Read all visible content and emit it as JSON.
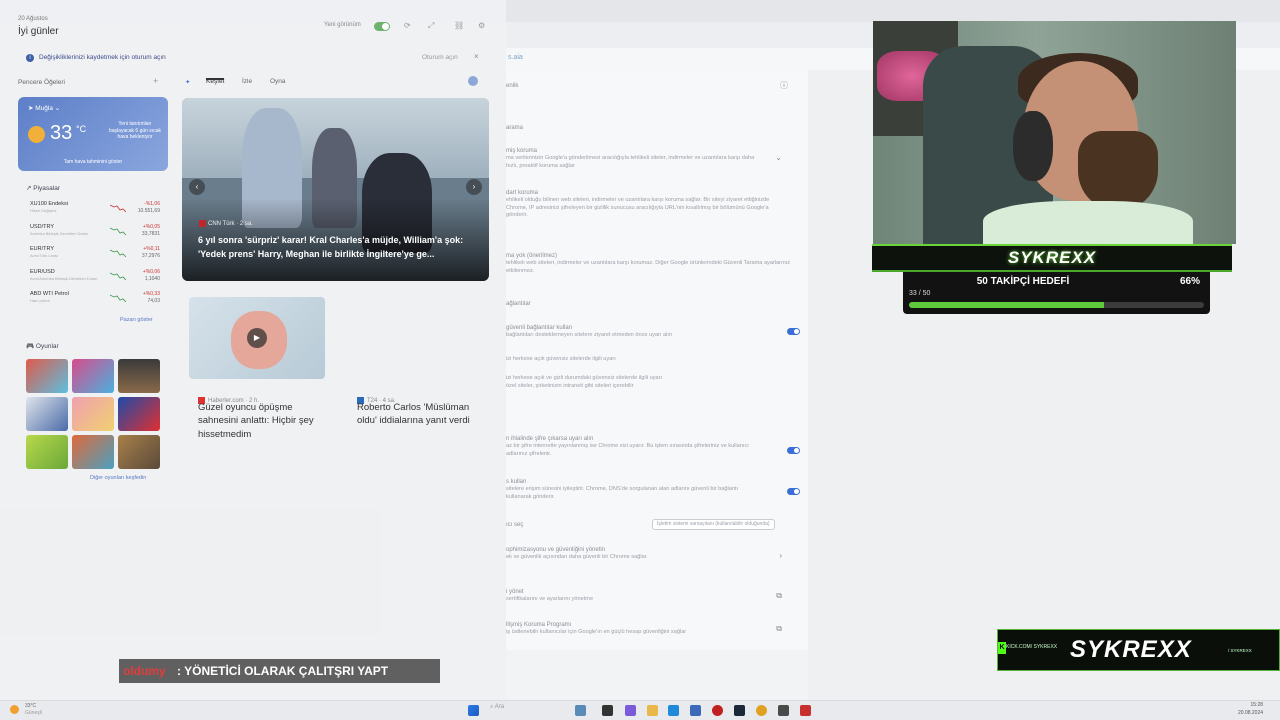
{
  "widgets": {
    "date": "20 Ağustos",
    "greeting": "İyi günler",
    "new_look_label": "Yeni görünüm",
    "notice": {
      "text": "Değişikliklerinizi kaydetmek için oturum açın",
      "signin": "Oturum açın"
    },
    "panels_label": "Pencere Öğeleri",
    "weather": {
      "city": "Muğla",
      "temp": "33",
      "unit": "°C",
      "note": "Yeni tanıtımları başlayacak 6 gün sıcak hava bekleniyor",
      "link": "Tam hava tahminini göster"
    },
    "markets": {
      "title": "Piyasalar",
      "more": "Pazarı göster",
      "items": [
        {
          "name": "XU100 Endeksi",
          "sub": "Hisse Değişimi",
          "change": "-%1,06",
          "value": "10.551,69"
        },
        {
          "name": "USD/TRY",
          "sub": "Amerika Birleşik Devletleri Doları",
          "change": "+%0,05",
          "value": "33,7831"
        },
        {
          "name": "EUR/TRY",
          "sub": "Avro/Türk Lirası",
          "change": "+%0,11",
          "value": "37,2976"
        },
        {
          "name": "EUR/USD",
          "sub": "Avro/Amerika Birleşik Devletleri Doları",
          "change": "+%0,06",
          "value": "1,1040"
        },
        {
          "name": "ABD WTI Petrol",
          "sub": "Ham petrol",
          "change": "+%0,33",
          "value": "74,03"
        }
      ]
    },
    "games": {
      "title": "Oyunlar",
      "more": "Diğer oyunları keşfedin"
    },
    "feed": {
      "tabs": [
        "Keşfet",
        "İzle",
        "Oyna"
      ]
    },
    "hero": {
      "source": "CNN Türk · 2 sa.",
      "title": "6 yıl sonra 'sürpriz' karar! Kral Charles'a müjde, William'a şok: 'Yedek prens' Harry, Meghan ile birlikte İngiltere'ye ge..."
    },
    "cards": [
      {
        "source": "Haberler.com · 2 h.",
        "title": "Güzel oyuncu öpüşme sahnesini anlattı: Hiçbir şey hissetmedim"
      },
      {
        "source": "T24 · 4 sa.",
        "title": "Roberto Carlos 'Müslüman oldu' iddialarına yanıt verdi"
      }
    ]
  },
  "settings": {
    "address": "s.aia",
    "rows": [
      {
        "title": "enlik",
        "desc": ""
      },
      {
        "title": "arama",
        "desc": ""
      },
      {
        "title": "miş koruma",
        "desc": "ma verilerinizin Google'a gönderilmesi aracılığıyla tehlikeli siteler, indirmeler ve uzantılara karşı daha hızlı, proaktif koruma sağlar"
      },
      {
        "title": "dart koruma",
        "desc": "ehlikeli olduğu bilinen web siteleri, indirmeler ve uzantılara karşı koruma sağlar. Bir siteyi ziyaret ettiğinizde Chrome, IP adresinizi şifreleyen bir gizlilik sunucusu aracılığıyla URL'nin kısaltılmış bir bölümünü Google'a gönderir."
      },
      {
        "title": "ma yok (önerilmez)",
        "desc": "tehlikeli web siteleri, indirmeler ve uzantılara karşı korumaz. Diğer Google ürünlerindeki Güvenli Tarama ayarlarınız etkilenmez."
      },
      {
        "title": "ağlantılar",
        "desc": ""
      },
      {
        "title": "güvenli bağlantılar kullan",
        "desc": "bağlantıları desteklemeyen sitelere ziyaret etmeden önce uyarı alın"
      },
      {
        "title": "izi herkese açık güvensiz sitelerde ilgili uyarı",
        "desc": ""
      },
      {
        "title": "izi herkese açık ve gizli durumdaki güvensiz sitelerde ilgili uyarı",
        "desc": "özel siteler, şirketinizin intraneti gibi siteleri içerebilir"
      },
      {
        "title": "n ihlalinde şifre çıkarsa uyarı alın",
        "desc": "az bir şifre internette yayınlanmış ise Chrome sizi uyarır. Bu işlem sırasında şifreleriniz ve kullanıcı adlarınız şifrelenir."
      },
      {
        "title": "s kullan",
        "desc": "sitelere erişim süresini iyileştirir. Chrome, DNS'de sorgulanan alan adlarını güvenli bir bağlantı kullanarak gönderir."
      },
      {
        "title": "ıcı seç",
        "desc": ""
      },
      {
        "title": "ophimizasyonu ve güvenliğini yönetin",
        "desc": "ek ve güvenlik açısından daha güvenli bir Chrome sağlar."
      },
      {
        "title": "i yönet",
        "desc": "sertifikalarını ve ayarlarını yönetme"
      },
      {
        "title": "llişmiş Koruma Programı",
        "desc": "iş üstlenebilir kullanıcılar için Google'ın en güçlü hesap güvenliğini sağlar"
      }
    ],
    "dns_select": "İşletim sistemi varsayılanı (kullanılabilir olduğunda)"
  },
  "overlay": {
    "streamer_name": "SYKREXX",
    "goal": {
      "title": "50 TAKİPÇİ HEDEFİ",
      "count": "33 / 50",
      "percent_label": "66%",
      "progress": 0.66
    },
    "banner": {
      "logo": "SYKREXX",
      "left_text": "KICK.COM/ SYKREXX",
      "right_text": "/ SYKREXX"
    },
    "chat": {
      "user": "oldumy",
      "message": ": YÖNETİCİ OLARAK ÇALITŞRI YAPT"
    }
  },
  "taskbar": {
    "weather_temp": "33°C",
    "weather_desc": "Güneşli",
    "search": "Ara",
    "time": "15:28",
    "date": "20.08.2024"
  },
  "colors": {
    "accent_blue": "#3b6fd8",
    "goal_green": "#5ec93a",
    "chat_user_red": "#e23c3c",
    "weather_card": "#5d7fc8"
  }
}
